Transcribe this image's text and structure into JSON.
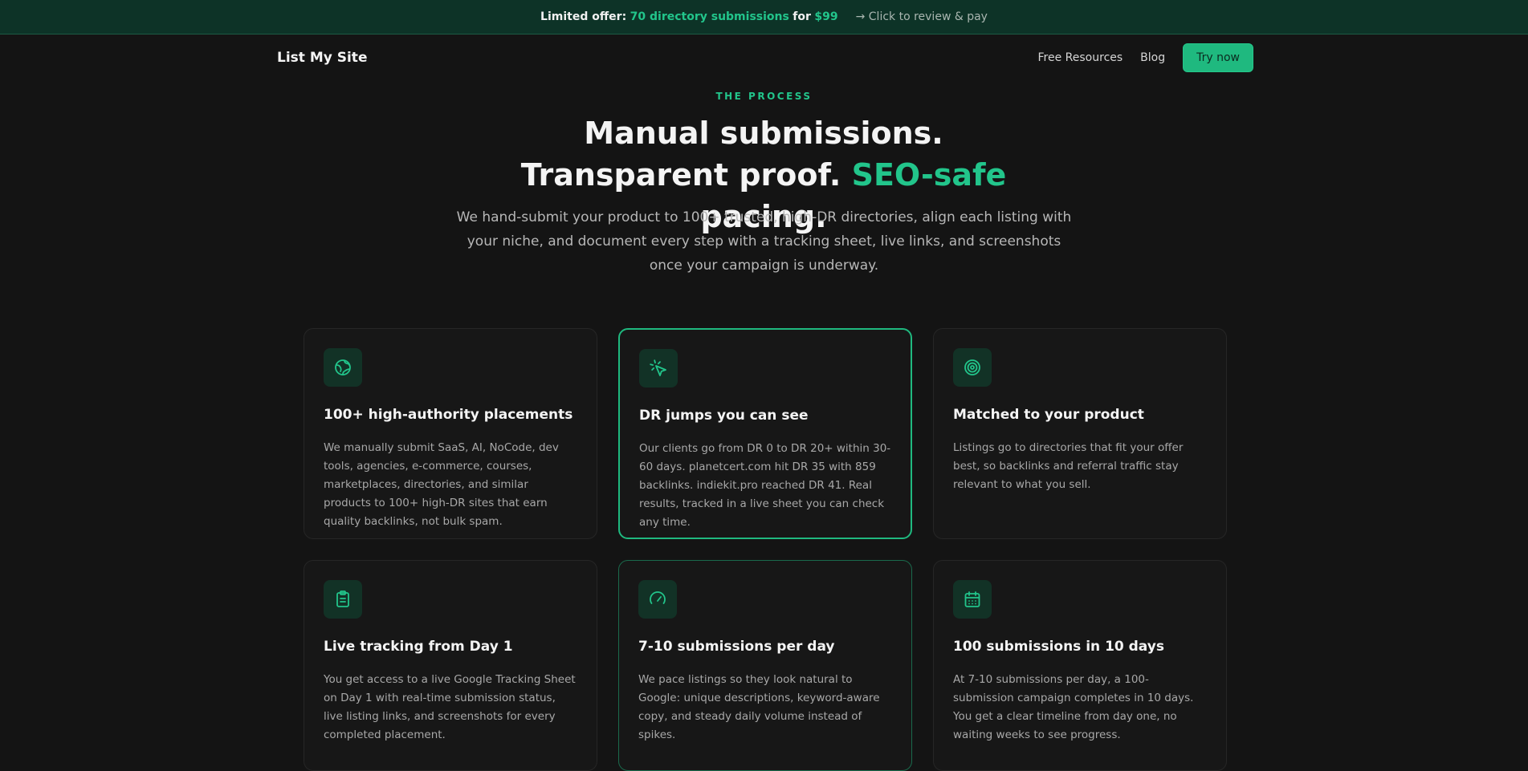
{
  "banner": {
    "offer_prefix": "Limited offer:",
    "offer_highlight": "70 directory submissions",
    "offer_for": "for",
    "offer_price": "$99",
    "cta": "→ Click to review & pay"
  },
  "nav": {
    "logo": "List My Site",
    "links": [
      "Free Resources",
      "Blog"
    ],
    "cta": "Try now"
  },
  "hero": {
    "eyebrow": "THE PROCESS",
    "headline_part1": "Manual submissions. Transparent proof.",
    "headline_accent": "SEO-safe",
    "headline_part2": "pacing.",
    "subtitle": "We hand-submit your product to 100+ trusted, high-DR directories, align each listing with your niche, and document every step with a tracking sheet, live links, and screenshots once your campaign is underway."
  },
  "colors": {
    "accent": "#22c58b",
    "background": "#141414",
    "banner": "#0d3327"
  },
  "cards": [
    {
      "icon": "globe-icon",
      "title": "100+ high-authority placements",
      "text": "We manually submit SaaS, AI, NoCode, dev tools, agencies, e-commerce, courses, marketplaces, directories, and similar products to 100+ high-DR sites that earn quality backlinks, not bulk spam."
    },
    {
      "icon": "cursor-click-icon",
      "title": "DR jumps you can see",
      "text": "Our clients go from DR 0 to DR 20+ within 30-60 days. planetcert.com hit DR 35 with 859 backlinks. indiekit.pro reached DR 41. Real results, tracked in a live sheet you can check any time."
    },
    {
      "icon": "target-icon",
      "title": "Matched to your product",
      "text": "Listings go to directories that fit your offer best, so backlinks and referral traffic stay relevant to what you sell."
    },
    {
      "icon": "clipboard-icon",
      "title": "Live tracking from Day 1",
      "text": "You get access to a live Google Tracking Sheet on Day 1 with real-time submission status, live listing links, and screenshots for every completed placement."
    },
    {
      "icon": "gauge-icon",
      "title": "7-10 submissions per day",
      "text": "We pace listings so they look natural to Google: unique descriptions, keyword-aware copy, and steady daily volume instead of spikes."
    },
    {
      "icon": "calendar-icon",
      "title": "100 submissions in 10 days",
      "text": "At 7-10 submissions per day, a 100-submission campaign completes in 10 days. You get a clear timeline from day one, no waiting weeks to see progress."
    }
  ]
}
